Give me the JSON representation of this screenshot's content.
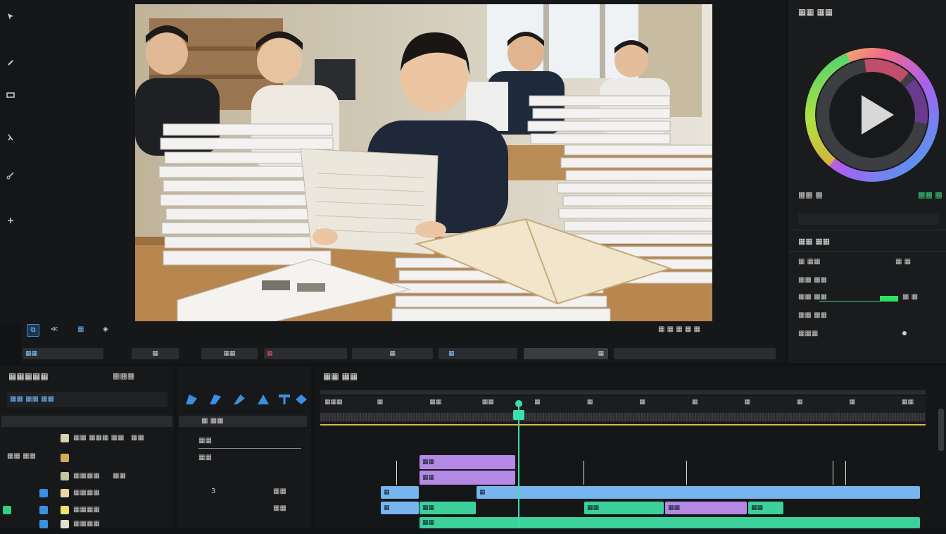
{
  "colors": {
    "accent_blue": "#3a8fe0",
    "clip_blue": "#78b4ee",
    "clip_purple": "#b489e6",
    "clip_green": "#3cd09a",
    "playhead": "#3ce0b0",
    "ruler_yellow": "#d8b84a"
  },
  "left_toolbar": {
    "icons": [
      "select-icon",
      "link-icon",
      "slip-icon",
      "razor-icon",
      "scissors-icon",
      "transform-icon"
    ]
  },
  "viewer": {
    "image_alt": "students-reading-papers",
    "toolbar_left": [
      "⧉",
      "≪",
      "▦",
      "◈"
    ],
    "toolbar_right_text": "▦ ▦ ▦ ▦ ▦"
  },
  "right_panel": {
    "title": "▦▦ ▦▦",
    "wheel_play": "play",
    "row1_left": "▦▦ ▦",
    "row1_right": "▦▦ ▦",
    "section": "▦▦ ▦▦",
    "items": [
      {
        "label": "▦ ▦▦",
        "value": "▦ ▦"
      },
      {
        "label": "▦▦ ▦▦",
        "value": ""
      },
      {
        "label": "▦▦ ▦▦",
        "value": "▦ ▦"
      },
      {
        "label": "▦▦ ▦▦",
        "value": ""
      },
      {
        "label": "▦▦▦",
        "value": ""
      }
    ]
  },
  "transport": {
    "buttons": [
      "▦▦",
      "▦",
      "▦▦",
      "▦",
      "▦",
      "▦",
      "▦"
    ]
  },
  "media_panel": {
    "title": "▦▦▦▦▦",
    "search_value": "▦▦ ▦▦ ▦▦",
    "header_tab": "▦▦▦",
    "rows": [
      {
        "name": "▦▦ ▦▦▦ ▦▦",
        "meta": "▦▦"
      },
      {
        "name": "▦▦ ▦▦",
        "meta": ""
      },
      {
        "name": "▦▦▦▦",
        "meta": "▦▦"
      },
      {
        "name": "▦▦▦▦",
        "meta": "▦▦"
      },
      {
        "name": "▦▦▦▦",
        "meta": ""
      },
      {
        "name": "▦▦▦▦",
        "meta": ""
      },
      {
        "name": "▦▦▦▦",
        "meta": ""
      }
    ]
  },
  "effects_panel": {
    "header": "▦ ▦▦",
    "rows": [
      {
        "label": "▦▦",
        "value": "◆"
      },
      {
        "label": "▦▦",
        "value": ""
      },
      {
        "label": "3",
        "value": "▦▦"
      },
      {
        "label": "▦▦",
        "value": "▦▦"
      }
    ]
  },
  "timeline": {
    "title": "▦▦ ▦▦",
    "ruler_labels": [
      "▦▦▦",
      "▦",
      "▦▦",
      "▦▦",
      "▦",
      "▦",
      "▦",
      "▦",
      "▦",
      "▦",
      "▦",
      "▦▦"
    ],
    "clips_blue": [
      "▦",
      "▦",
      "▦",
      "▦",
      "▦",
      "▦",
      "▦",
      "▦",
      "▦",
      "▦",
      "▦",
      "▦"
    ],
    "clips_purple": [
      "▦▦",
      "▦▦",
      "▦▦",
      "▦▦"
    ],
    "clips_green": [
      "▦▦",
      "▦▦",
      "▦▦",
      "▦▦"
    ]
  }
}
